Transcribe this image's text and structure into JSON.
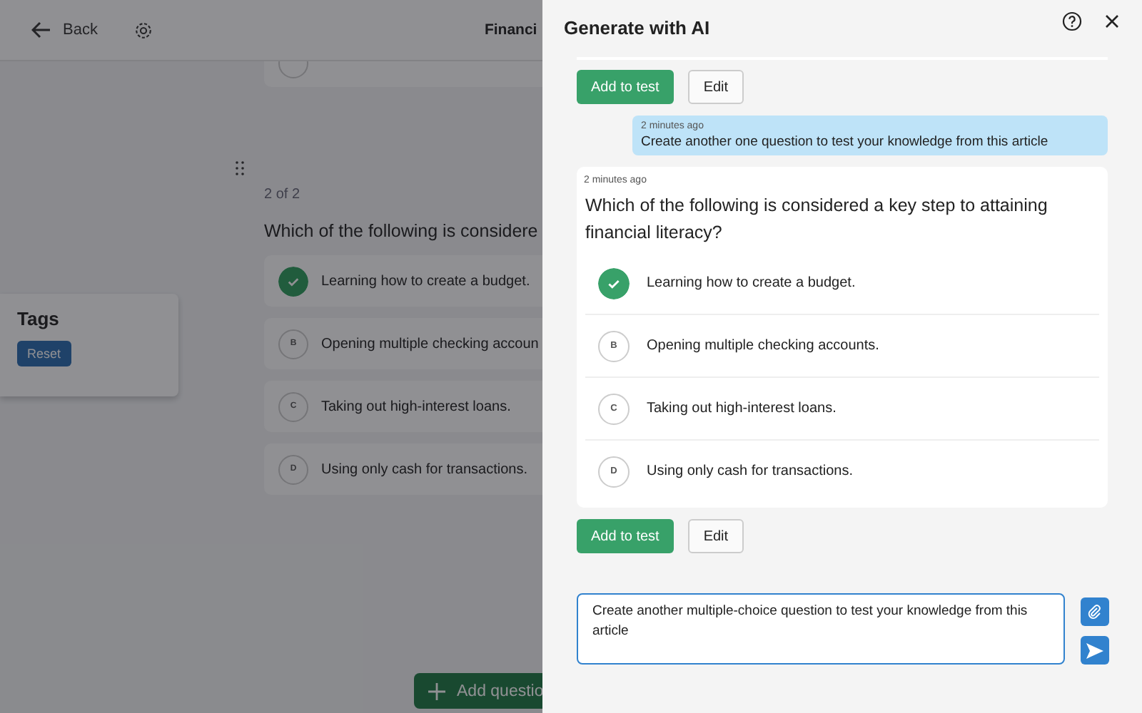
{
  "page": {
    "back_label": "Back",
    "title": "Financi",
    "counter": "2 of 2",
    "question": "Which of the following is considere",
    "options": [
      {
        "text": "Learning how to create a budget.",
        "correct": true
      },
      {
        "letter": "B",
        "text": "Opening multiple checking accoun",
        "correct": false
      },
      {
        "letter": "C",
        "text": "Taking out high-interest loans.",
        "correct": false
      },
      {
        "letter": "D",
        "text": "Using only cash for transactions.",
        "correct": false
      }
    ],
    "tags": {
      "title": "Tags",
      "reset": "Reset"
    },
    "add_question": "Add questio"
  },
  "panel": {
    "title": "Generate with AI",
    "thread": [
      {
        "kind": "actions",
        "add": "Add to test",
        "edit": "Edit"
      },
      {
        "kind": "user",
        "time": "2 minutes ago",
        "text": "Create another one question to test your knowledge from this article"
      },
      {
        "kind": "ai",
        "time": "2 minutes ago",
        "question": "Which of the following is considered a key step to attaining financial literacy?",
        "options": [
          {
            "text": "Learning how to create a budget.",
            "correct": true
          },
          {
            "letter": "B",
            "text": "Opening multiple checking accounts.",
            "correct": false
          },
          {
            "letter": "C",
            "text": "Taking out high-interest loans.",
            "correct": false
          },
          {
            "letter": "D",
            "text": "Using only cash for transactions.",
            "correct": false
          }
        ]
      },
      {
        "kind": "actions",
        "add": "Add to test",
        "edit": "Edit"
      }
    ],
    "composer": {
      "value": "Create another multiple-choice question to test your knowledge from this article"
    }
  }
}
